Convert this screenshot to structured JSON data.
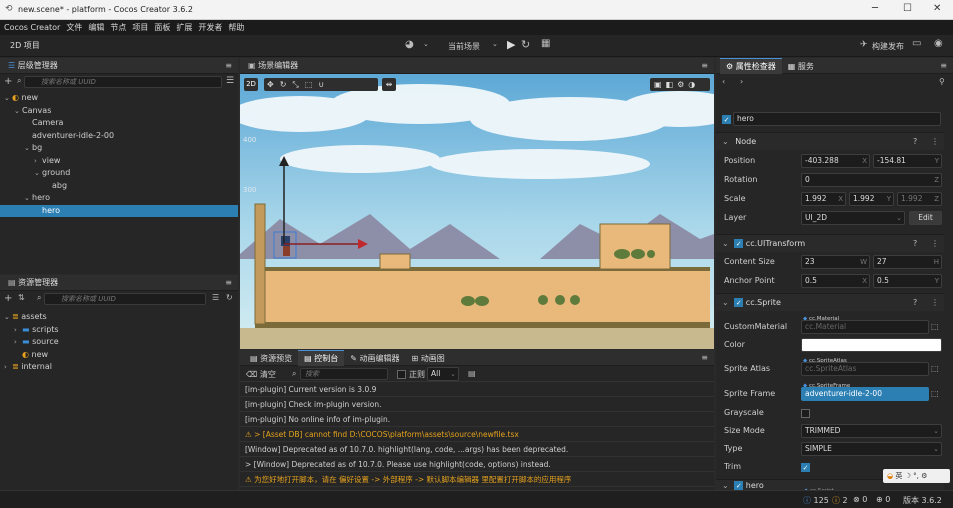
{
  "window": {
    "title": "new.scene* - platform - Cocos Creator 3.6.2",
    "controls": [
      "─",
      "☐",
      "✕"
    ]
  },
  "menu": [
    "Cocos Creator",
    "文件",
    "编辑",
    "节点",
    "项目",
    "面板",
    "扩展",
    "开发者",
    "帮助"
  ],
  "toolbar": {
    "mode": "2D 项目",
    "scene_select": "当前场景",
    "build_publish": "构建发布"
  },
  "hierarchy": {
    "title": "层级管理器",
    "search_placeholder": "搜索名称或 UUID",
    "nodes": [
      {
        "label": "new",
        "depth": 0,
        "arrow": "down",
        "icon": "scene"
      },
      {
        "label": "Canvas",
        "depth": 1,
        "arrow": "down"
      },
      {
        "label": "Camera",
        "depth": 2,
        "arrow": ""
      },
      {
        "label": "adventurer-idle-2-00",
        "depth": 2,
        "arrow": ""
      },
      {
        "label": "bg",
        "depth": 2,
        "arrow": "down"
      },
      {
        "label": "view",
        "depth": 3,
        "arrow": "right"
      },
      {
        "label": "ground",
        "depth": 3,
        "arrow": "down"
      },
      {
        "label": "abg",
        "depth": 4,
        "arrow": ""
      },
      {
        "label": "hero",
        "depth": 2,
        "arrow": "down"
      },
      {
        "label": "hero",
        "depth": 3,
        "arrow": "",
        "selected": true
      }
    ]
  },
  "assets": {
    "title": "资源管理器",
    "search_placeholder": "搜索名称或 UUID",
    "items": [
      {
        "label": "assets",
        "depth": 0,
        "arrow": "down",
        "icon": "db"
      },
      {
        "label": "scripts",
        "depth": 1,
        "arrow": "right",
        "icon": "folder"
      },
      {
        "label": "source",
        "depth": 1,
        "arrow": "right",
        "icon": "folder"
      },
      {
        "label": "new",
        "depth": 1,
        "arrow": "",
        "icon": "scene"
      },
      {
        "label": "internal",
        "depth": 0,
        "arrow": "right",
        "icon": "db"
      }
    ]
  },
  "scene": {
    "title": "场景编辑器",
    "mode_2d": "2D",
    "ruler_labels": [
      "400",
      "300"
    ]
  },
  "bottom": {
    "tabs": [
      "资源预览",
      "控制台",
      "动画编辑器",
      "动画图"
    ],
    "active_tab": 1,
    "clear": "清空",
    "search_placeholder": "搜索",
    "regex": "正则",
    "filter": "All",
    "logs": [
      {
        "text": "[im-plugin] Current version is 3.0.9",
        "type": "info"
      },
      {
        "text": "[im-plugin] Check im-plugin version.",
        "type": "info"
      },
      {
        "text": "[im-plugin] No online info of im-plugin.",
        "type": "info"
      },
      {
        "text": "> [Asset DB] cannot find D:\\COCOS\\platform\\assets\\source\\newfile.tsx",
        "type": "warn"
      },
      {
        "text": "[Window] Deprecated as of 10.7.0. highlight(lang, code, ...args) has been deprecated.",
        "type": "info"
      },
      {
        "text": "> [Window] Deprecated as of 10.7.0. Please use highlight(code, options) instead.",
        "type": "info"
      },
      {
        "text": "为您好地打开脚本，请在 偏好设置 -> 外部程序 -> 默认脚本编辑器 里配置打开脚本的应用程序",
        "type": "warn"
      }
    ]
  },
  "inspector": {
    "tabs": [
      "属性检查器",
      "服务"
    ],
    "node_name": "hero",
    "node_section": "Node",
    "position": {
      "label": "Position",
      "x": "-403.288",
      "y": "-154.81"
    },
    "rotation": {
      "label": "Rotation",
      "value": "0"
    },
    "scale": {
      "label": "Scale",
      "x": "1.992",
      "y": "1.992",
      "z": "1.992"
    },
    "layer": {
      "label": "Layer",
      "value": "UI_2D",
      "edit": "Edit"
    },
    "uitransform": {
      "title": "cc.UITransform",
      "content_size_label": "Content Size",
      "w": "23",
      "h": "27",
      "anchor_label": "Anchor Point",
      "ax": "0.5",
      "ay": "0.5"
    },
    "sprite": {
      "title": "cc.Sprite",
      "custom_material_label": "CustomMaterial",
      "custom_material_tag": "cc.Material",
      "custom_material_value": "cc.Material",
      "color_label": "Color",
      "atlas_label": "Sprite Atlas",
      "atlas_tag": "cc.SpriteAtlas",
      "atlas_value": "cc.SpriteAtlas",
      "frame_label": "Sprite Frame",
      "frame_tag": "cc.SpriteFrame",
      "frame_value": "adventurer-idle-2-00",
      "grayscale_label": "Grayscale",
      "size_mode_label": "Size Mode",
      "size_mode": "TRIMMED",
      "type_label": "Type",
      "type": "SIMPLE",
      "trim_label": "Trim"
    },
    "hero_component": "hero",
    "script_tag": "cc.Script"
  },
  "ime": "英",
  "statusbar": {
    "info": "125",
    "warn": "2",
    "error": "0",
    "extra": "0",
    "version": "版本 3.6.2"
  }
}
